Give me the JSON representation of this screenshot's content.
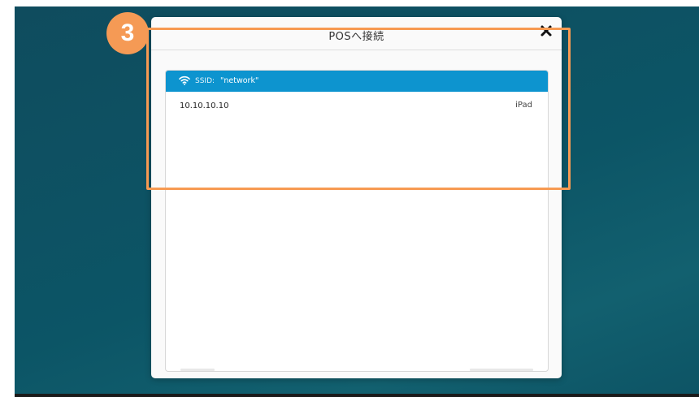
{
  "dialog": {
    "title": "POSへ接続",
    "close_icon": "close-icon"
  },
  "network": {
    "icon": "wifi-icon",
    "ssid_label": "SSID:",
    "ssid_value": "\"network\""
  },
  "devices": [
    {
      "ip": "10.10.10.10",
      "name": "iPad"
    }
  ],
  "annotation": {
    "step_number": "3"
  },
  "colors": {
    "background": "#0f4c5e",
    "network_bar": "#0d94cf",
    "highlight": "#f79a52",
    "badge": "#f59a55",
    "dialog": "#fafafa"
  }
}
